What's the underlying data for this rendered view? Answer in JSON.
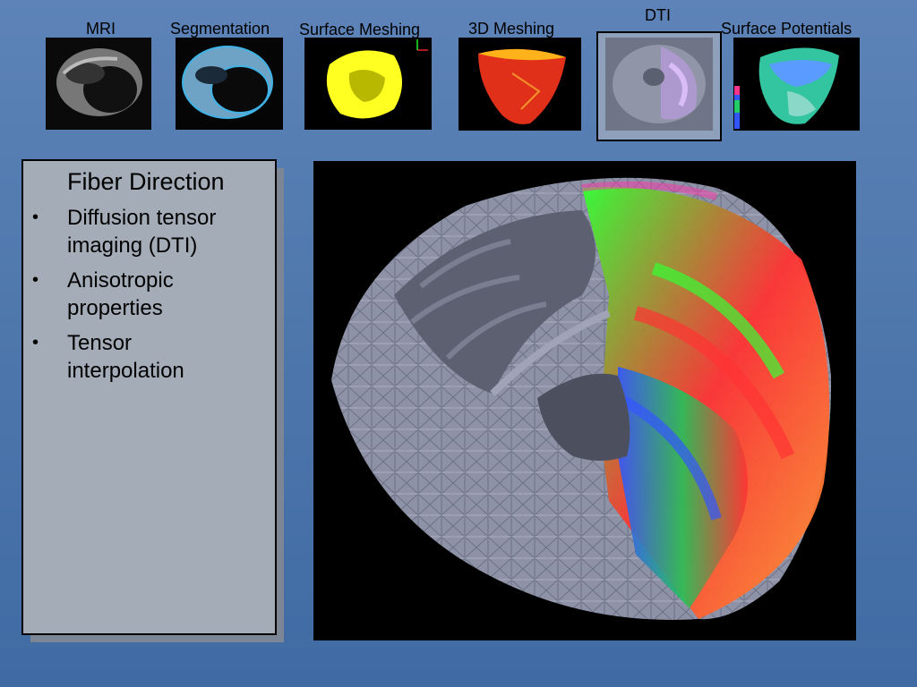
{
  "pipeline": {
    "stages": [
      {
        "label": "MRI",
        "icon": "mri-thumbnail"
      },
      {
        "label": "Segmentation",
        "icon": "segmentation-thumbnail"
      },
      {
        "label": "Surface Meshing",
        "icon": "surface-mesh-thumbnail"
      },
      {
        "label": "3D Meshing",
        "icon": "volume-mesh-thumbnail"
      },
      {
        "label": "DTI",
        "icon": "dti-thumbnail",
        "selected": true
      },
      {
        "label": "Surface Potentials",
        "icon": "surface-potentials-thumbnail"
      }
    ]
  },
  "panel": {
    "title": "Fiber Direction",
    "bullets": [
      "Diffusion tensor imaging (DTI)",
      "Anisotropic properties",
      "Tensor interpolation"
    ],
    "bullet_glyph": "•"
  },
  "figure": {
    "icon": "heart-fiber-dti-render",
    "colors": {
      "mesh": "#8e92a6",
      "fibers": [
        "#22c35a",
        "#33ff33",
        "#ff3333",
        "#3355ff",
        "#ff9933",
        "#ff33aa"
      ]
    }
  }
}
